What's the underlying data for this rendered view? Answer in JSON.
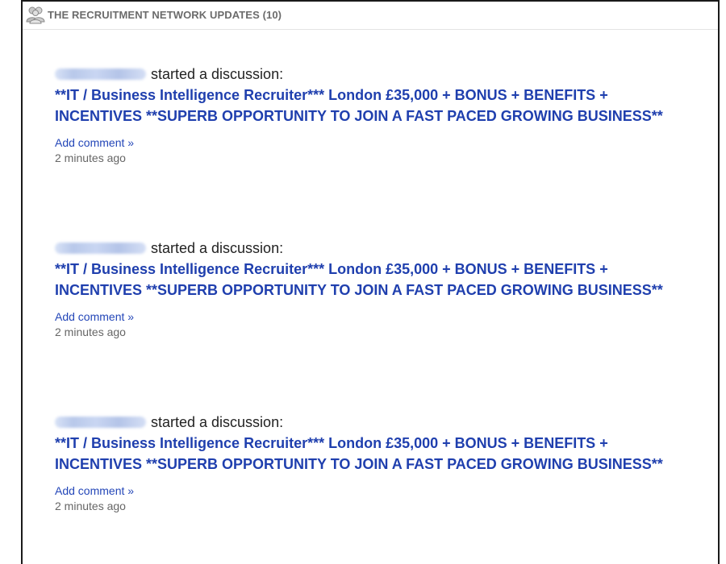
{
  "header": {
    "icon": "group-icon",
    "title": "THE RECRUITMENT NETWORK UPDATES (10)"
  },
  "updates": [
    {
      "action": "started a discussion:",
      "title": "**IT / Business Intelligence Recruiter*** London £35,000 + BONUS + BENEFITS + INCENTIVES **SUPERB OPPORTUNITY TO JOIN A FAST PACED GROWING BUSINESS**",
      "add_comment": "Add comment »",
      "time": "2 minutes ago"
    },
    {
      "action": "started a discussion:",
      "title": "**IT / Business Intelligence Recruiter*** London £35,000 + BONUS + BENEFITS + INCENTIVES **SUPERB OPPORTUNITY TO JOIN A FAST PACED GROWING BUSINESS**",
      "add_comment": "Add comment »",
      "time": "2 minutes ago"
    },
    {
      "action": "started a discussion:",
      "title": "**IT / Business Intelligence Recruiter*** London £35,000 + BONUS + BENEFITS + INCENTIVES **SUPERB OPPORTUNITY TO JOIN A FAST PACED GROWING BUSINESS**",
      "add_comment": "Add comment »",
      "time": "2 minutes ago"
    }
  ],
  "colors": {
    "link": "#1f3fae",
    "header_text": "#6b6b6b",
    "timestamp": "#666666"
  }
}
